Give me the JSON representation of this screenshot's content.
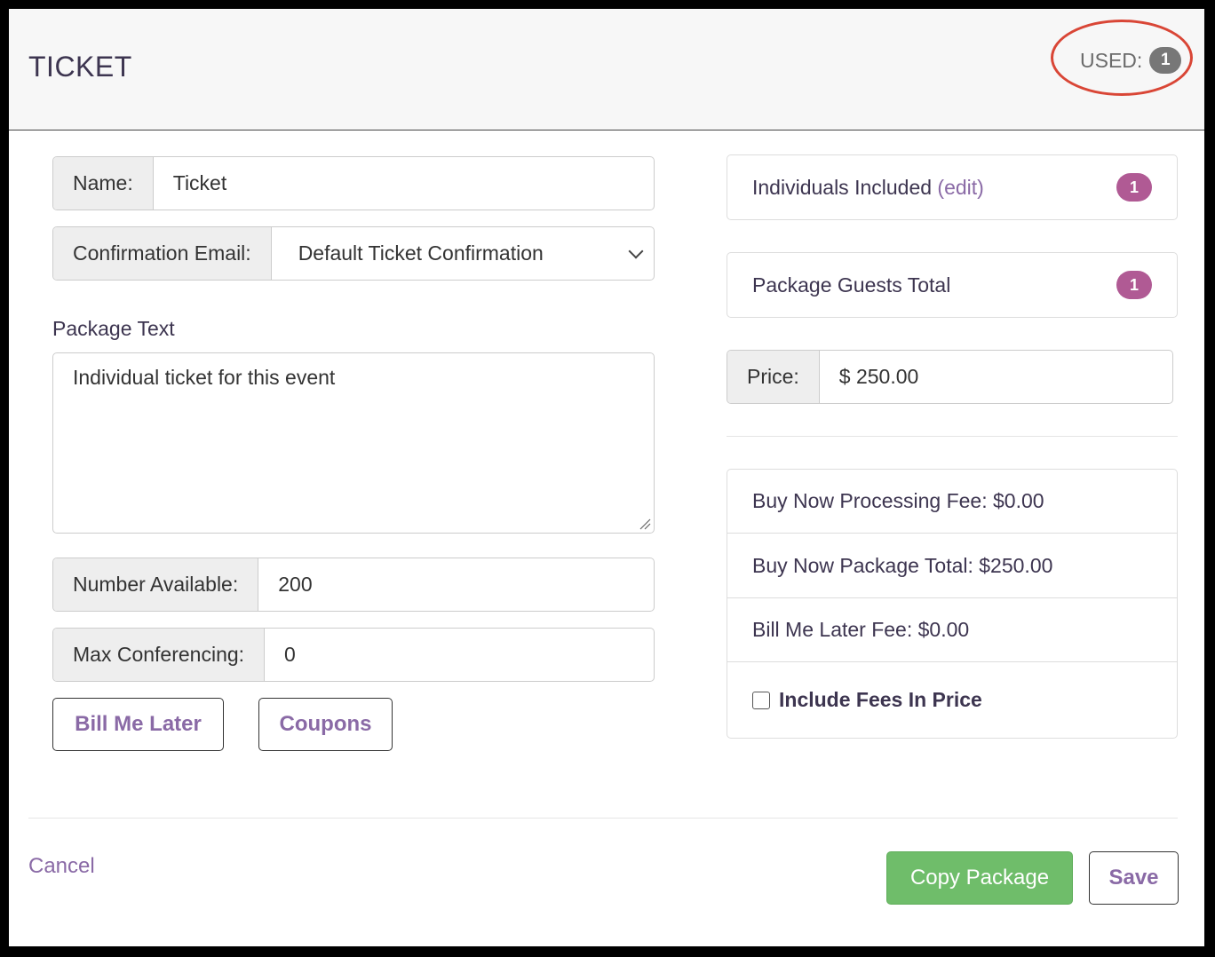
{
  "header": {
    "title": "TICKET",
    "used_label": "USED:",
    "used_count": "1",
    "annotation_color": "#d94636"
  },
  "form": {
    "name_label": "Name:",
    "name_value": "Ticket",
    "confirmation_label": "Confirmation Email:",
    "confirmation_value": "Default Ticket Confirmation",
    "package_text_label": "Package Text",
    "package_text_value": "Individual ticket for this event",
    "number_available_label": "Number Available:",
    "number_available_value": "200",
    "max_conferencing_label": "Max Conferencing:",
    "max_conferencing_value": "0",
    "bill_me_later_label": "Bill Me Later",
    "coupons_label": "Coupons"
  },
  "summary": {
    "individuals_label": "Individuals Included",
    "individuals_edit": "(edit)",
    "individuals_count": "1",
    "guests_label": "Package Guests Total",
    "guests_count": "1",
    "price_label": "Price:",
    "price_value": "$ 250.00",
    "processing_fee": "Buy Now Processing Fee: $0.00",
    "package_total": "Buy Now Package Total: $250.00",
    "bill_later_fee": "Bill Me Later Fee: $0.00",
    "include_fees_label": "Include Fees In Price",
    "include_fees_checked": false
  },
  "footer": {
    "cancel_label": "Cancel",
    "copy_label": "Copy Package",
    "save_label": "Save"
  },
  "colors": {
    "accent_purple": "#8a6aa6",
    "badge_pink": "#b05a94",
    "success_green": "#6fbd6a",
    "used_badge_gray": "#777777"
  }
}
